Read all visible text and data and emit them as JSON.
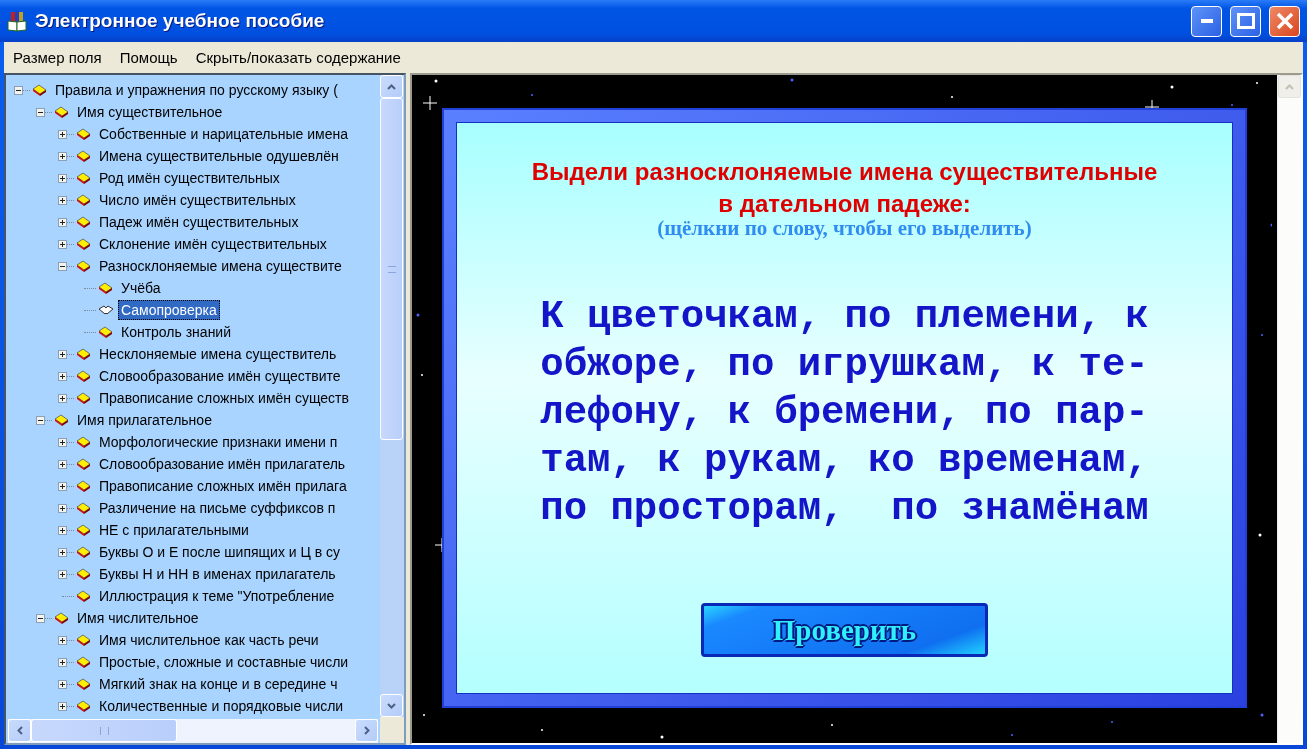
{
  "window": {
    "title": "Электронное учебное пособие"
  },
  "menu": [
    {
      "label": "Размер поля"
    },
    {
      "label": "Помощь"
    },
    {
      "label": "Скрыть/показать содержание"
    }
  ],
  "tree": [
    {
      "label": "Правила и упражнения по русскому языку (",
      "kind": "folder",
      "expanded": true,
      "selected": false,
      "children": [
        {
          "label": "Имя существительное",
          "kind": "folder",
          "expanded": true,
          "selected": false,
          "children": [
            {
              "label": "Собственные и нарицательные имена",
              "kind": "folder",
              "expanded": false,
              "selected": false
            },
            {
              "label": "Имена существительные одушевлён",
              "kind": "folder",
              "expanded": false,
              "selected": false
            },
            {
              "label": "Род имён существительных",
              "kind": "folder",
              "expanded": false,
              "selected": false
            },
            {
              "label": "Число имён существительных",
              "kind": "folder",
              "expanded": false,
              "selected": false
            },
            {
              "label": "Падеж имён существительных",
              "kind": "folder",
              "expanded": false,
              "selected": false
            },
            {
              "label": "Склонение имён существительных",
              "kind": "folder",
              "expanded": false,
              "selected": false
            },
            {
              "label": "Разносклоняемые имена существите",
              "kind": "folder",
              "expanded": true,
              "selected": false,
              "children": [
                {
                  "label": "Учёба",
                  "kind": "leaf",
                  "selected": false
                },
                {
                  "label": "Самопроверка",
                  "kind": "leaf",
                  "selected": true
                },
                {
                  "label": "Контроль знаний",
                  "kind": "leaf",
                  "selected": false
                }
              ]
            },
            {
              "label": "Несклоняемые имена существитель",
              "kind": "folder",
              "expanded": false,
              "selected": false
            },
            {
              "label": "Словообразование имён существите",
              "kind": "folder",
              "expanded": false,
              "selected": false
            },
            {
              "label": "Правописание сложных имён существ",
              "kind": "folder",
              "expanded": false,
              "selected": false
            }
          ]
        },
        {
          "label": "Имя прилагательное",
          "kind": "folder",
          "expanded": true,
          "selected": false,
          "children": [
            {
              "label": "Морфологические признаки имени п",
              "kind": "folder",
              "expanded": false,
              "selected": false
            },
            {
              "label": "Словообразование имён прилагатель",
              "kind": "folder",
              "expanded": false,
              "selected": false
            },
            {
              "label": "Правописание сложных имён прилага",
              "kind": "folder",
              "expanded": false,
              "selected": false
            },
            {
              "label": "Различение на письме суффиксов п",
              "kind": "folder",
              "expanded": false,
              "selected": false
            },
            {
              "label": "НЕ с прилагательными",
              "kind": "folder",
              "expanded": false,
              "selected": false
            },
            {
              "label": "Буквы О и Е после шипящих и Ц в су",
              "kind": "folder",
              "expanded": false,
              "selected": false
            },
            {
              "label": "Буквы Н и НН в именах прилагатель",
              "kind": "folder",
              "expanded": false,
              "selected": false
            },
            {
              "label": "Иллюстрация к теме \"Употребление",
              "kind": "leaf",
              "selected": false
            }
          ]
        },
        {
          "label": "Имя числительное",
          "kind": "folder",
          "expanded": true,
          "selected": false,
          "children": [
            {
              "label": "Имя числительное как часть речи",
              "kind": "folder",
              "expanded": false,
              "selected": false
            },
            {
              "label": "Простые, сложные и составные числи",
              "kind": "folder",
              "expanded": false,
              "selected": false
            },
            {
              "label": "Мягкий знак на конце и в середине ч",
              "kind": "folder",
              "expanded": false,
              "selected": false
            },
            {
              "label": "Количественные и порядковые числи",
              "kind": "folder",
              "expanded": false,
              "selected": false
            }
          ]
        }
      ]
    }
  ],
  "exercise": {
    "title": "Выдели разносклоняемые имена существительные\nв дательном падеже:",
    "hint": "(щёлкни по слову, чтобы его выделить)",
    "text": "К цветочкам, по племени, к\nобжоре, по игрушкам, к те-\nлефону, к бремени, по пар-\nтам, к рукам, ко временам,\nпо просторам,  по знамёнам",
    "button": "Проверить"
  }
}
